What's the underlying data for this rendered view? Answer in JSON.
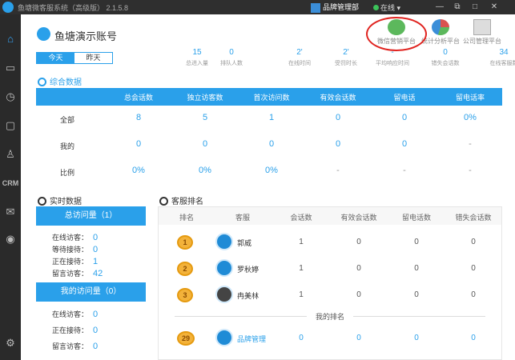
{
  "titlebar": {
    "app_title": "鱼塘微客服系统（高级版） 2.1.5.8",
    "user_name": "品牌管理部",
    "status": "在线 ▾",
    "min": "—",
    "restore": "⧉",
    "max": "□",
    "close": "✕"
  },
  "sidebar": {
    "crm_label": "CRM"
  },
  "account": {
    "name": "鱼塘演示账号"
  },
  "platforms": [
    {
      "label": "微信营销平台"
    },
    {
      "label": "统计分析平台"
    },
    {
      "label": "公司管理平台"
    }
  ],
  "date_tabs": {
    "today": "今天",
    "yesterday": "昨天"
  },
  "stats": [
    {
      "value": "15",
      "label": "总进入量"
    },
    {
      "value": "0",
      "label": "排队人数"
    },
    {
      "value": "2'",
      "label": "在线时间"
    },
    {
      "value": "2'",
      "label": "受罚时长"
    },
    {
      "value": "-",
      "label": "平均响应时间"
    },
    {
      "value": "0",
      "label": "错失会话数"
    },
    {
      "value": "34",
      "label": "在线客服数"
    }
  ],
  "summary": {
    "title": "综合数据",
    "headers": [
      "总会话数",
      "独立访客数",
      "首次访问数",
      "有效会话数",
      "留电话",
      "留电话率"
    ],
    "rows": [
      {
        "label": "全部",
        "values": [
          "8",
          "5",
          "1",
          "0",
          "0",
          "0%"
        ]
      },
      {
        "label": "我的",
        "values": [
          "0",
          "0",
          "0",
          "0",
          "0",
          "-"
        ]
      },
      {
        "label": "比例",
        "values": [
          "0%",
          "0%",
          "0%",
          "-",
          "-",
          "-"
        ]
      }
    ]
  },
  "realtime": {
    "title": "实时数据",
    "total_header": "总访问量（1）",
    "total_items": [
      {
        "label": "在线访客：",
        "value": "0"
      },
      {
        "label": "等待接待：",
        "value": "0"
      },
      {
        "label": "正在接待：",
        "value": "1"
      },
      {
        "label": "留言访客：",
        "value": "42"
      }
    ],
    "mine_header": "我的访问量（0）",
    "mine_items": [
      {
        "label": "在线访客：",
        "value": "0"
      },
      {
        "label": "正在接待：",
        "value": "0"
      },
      {
        "label": "留言访客：",
        "value": "0"
      }
    ]
  },
  "ranking": {
    "title": "客服排名",
    "headers": [
      "排名",
      "客服",
      "会话数",
      "有效会话数",
      "留电话数",
      "错失会话数"
    ],
    "rows": [
      {
        "rank": "1",
        "name": "郭威",
        "sessions": "1",
        "valid": "0",
        "phone": "0",
        "missed": "0"
      },
      {
        "rank": "2",
        "name": "罗秋婷",
        "sessions": "1",
        "valid": "0",
        "phone": "0",
        "missed": "0"
      },
      {
        "rank": "3",
        "name": "冉美林",
        "sessions": "1",
        "valid": "0",
        "phone": "0",
        "missed": "0"
      }
    ],
    "my_rank_label": "我的排名",
    "mine": {
      "rank": "29",
      "name": "品牌管理",
      "sessions": "0",
      "valid": "0",
      "phone": "0",
      "missed": "0"
    }
  },
  "colors": {
    "accent": "#2aa0ea",
    "sidebar": "#2a2a2a",
    "highlight": "#e0231f"
  }
}
